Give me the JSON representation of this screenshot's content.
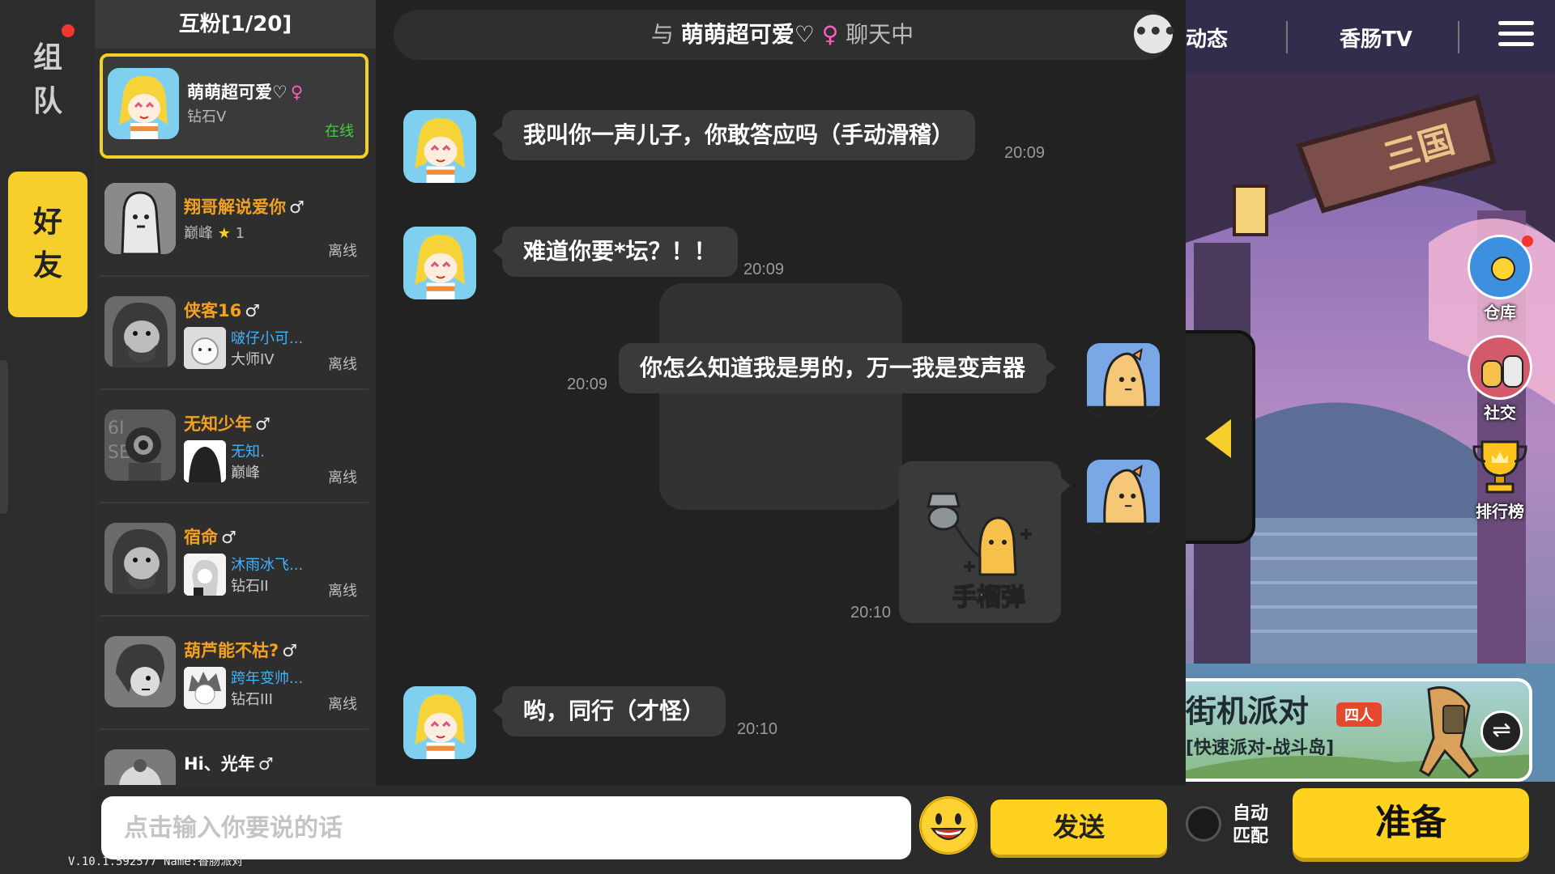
{
  "left_rail": {
    "team_label": "组\n队",
    "friends_label": "好\n友"
  },
  "version": "V.10.1.592577 Name:香肠派对",
  "friend_list": {
    "header": "互粉[1/20]",
    "items": [
      {
        "name": "萌萌超可爱♡",
        "gender": "♀",
        "rank": "钻石V",
        "status": "在线"
      },
      {
        "name": "翔哥解说爱你",
        "gender": "♂",
        "rank": "巅峰",
        "stars": "1",
        "status": "离线"
      },
      {
        "name": "侠客16",
        "gender": "♂",
        "sub_name": "啵仔小可...",
        "sub_rank": "大师IV",
        "status": "离线"
      },
      {
        "name": "无知少年",
        "gender": "♂",
        "sub_name": "无知.",
        "sub_rank": "巅峰",
        "status": "离线"
      },
      {
        "name": "宿命",
        "gender": "♂",
        "sub_name": "沐雨冰飞...",
        "sub_rank": "钻石II",
        "status": "离线"
      },
      {
        "name": "葫芦能不枯?",
        "gender": "♂",
        "sub_name": "跨年变帅...",
        "sub_rank": "钻石III",
        "status": "离线"
      },
      {
        "name": "Hi、光年",
        "gender": "♂"
      }
    ]
  },
  "chat": {
    "header_prefix": "与",
    "partner": "萌萌超可爱♡",
    "partner_gender": "♀",
    "header_suffix": "聊天中",
    "more_icon": "more-icon",
    "messages": [
      {
        "side": "left",
        "text": "我叫你一声儿子，你敢答应吗（手动滑稽）",
        "time": "20:09"
      },
      {
        "side": "left",
        "text": "难道你要*坛？！！",
        "time": "20:09"
      },
      {
        "side": "right",
        "text": "你怎么知道我是男的，万一我是变声器",
        "time": "20:09"
      },
      {
        "side": "right",
        "sticker": "sausage-sticker",
        "time": "20:10"
      },
      {
        "side": "left",
        "text": "哟，同行（才怪）",
        "time": "20:10"
      }
    ],
    "input_placeholder": "点击输入你要说的话",
    "send_label": "发送"
  },
  "game": {
    "nav": {
      "item1": "动态",
      "item2": "香肠TV"
    },
    "side_buttons": [
      {
        "label": "仓库",
        "icon": "warehouse-icon"
      },
      {
        "label": "社交",
        "icon": "social-icon"
      },
      {
        "label": "排行榜",
        "icon": "trophy-icon"
      }
    ],
    "mode": {
      "title": "街机派对",
      "badge": "四人",
      "subtitle": "[快速派对-战斗岛]"
    },
    "auto_match": "自动\n匹配",
    "ready_label": "准备"
  },
  "colors": {
    "accent_yellow": "#f7cf2d",
    "online_green": "#3fcf3f",
    "female_pink": "#ff5cc0",
    "name_orange": "#f4a020",
    "sub_name_blue": "#3fb3ff"
  }
}
